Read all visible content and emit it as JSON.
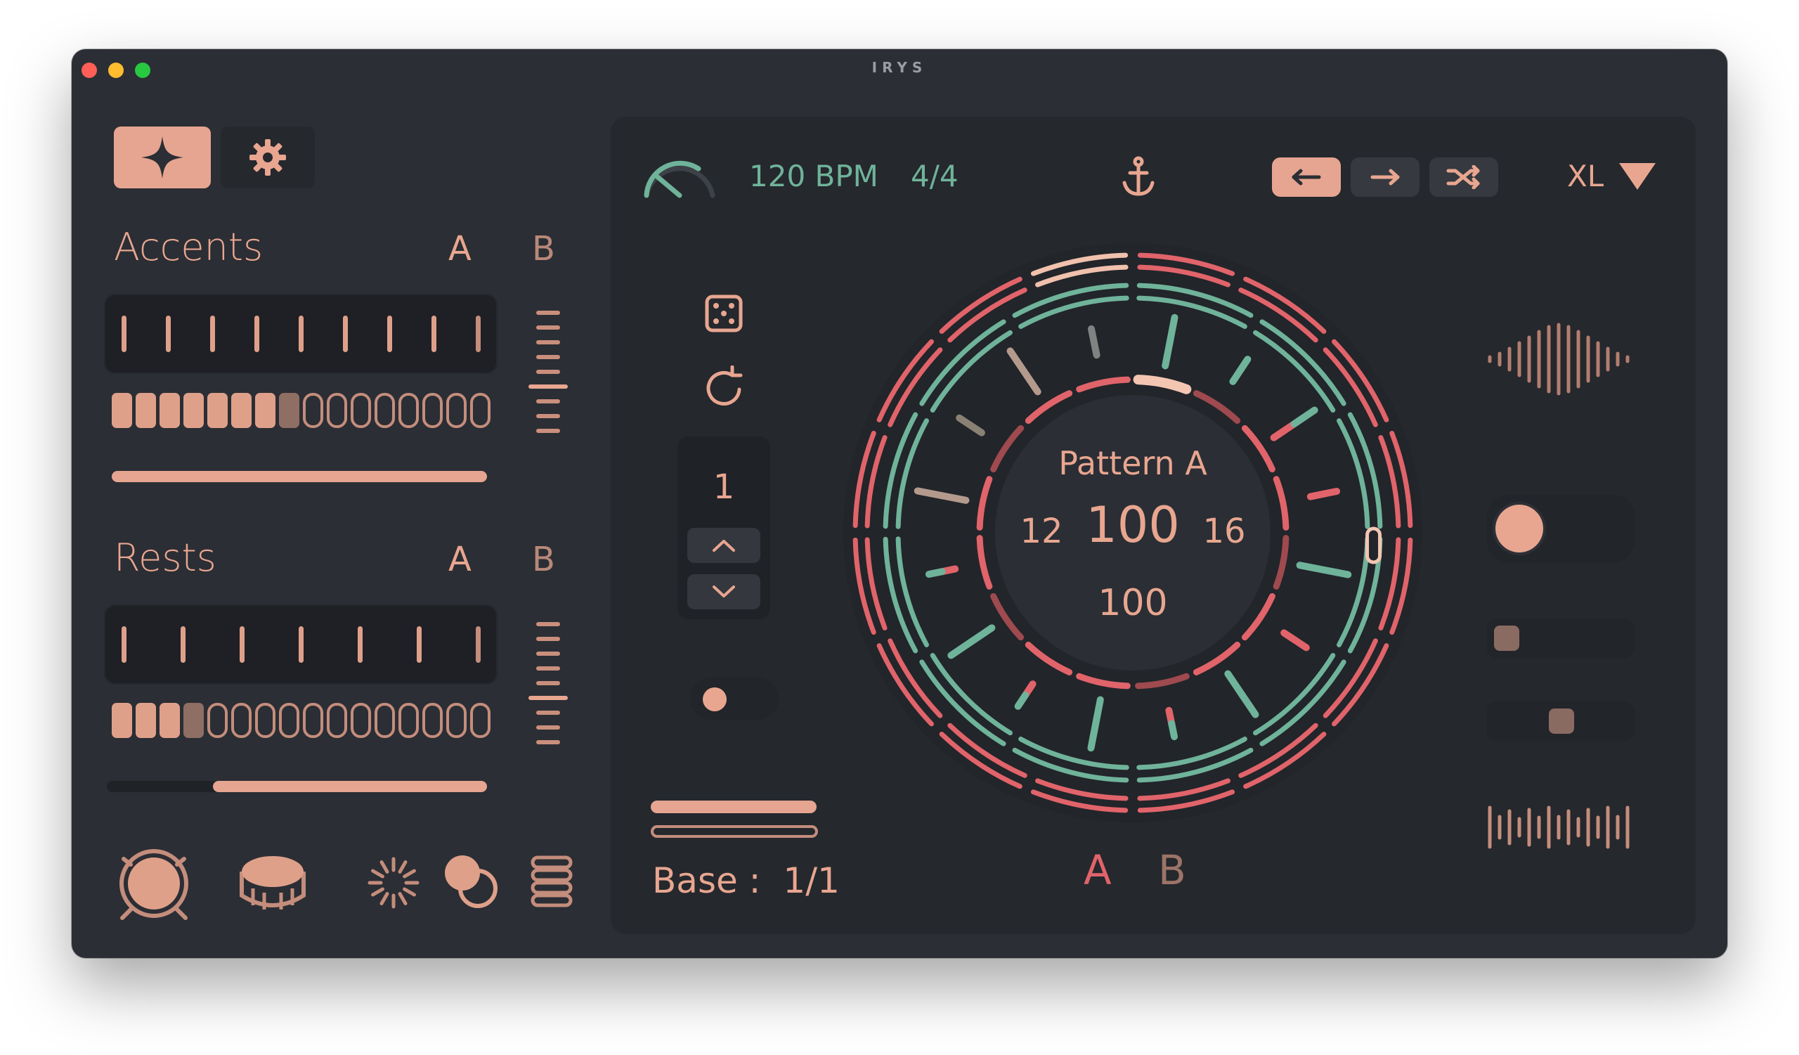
{
  "window": {
    "title": "IRYS",
    "traffic_lights": {
      "close": "#ff5f57",
      "minimize": "#febc2e",
      "zoom": "#28c840"
    }
  },
  "colors": {
    "accent": "#e8a690",
    "teal": "#6fb39a",
    "red": "#e0646a",
    "panel": "#25282d",
    "window": "#2b2e34"
  },
  "sidebar": {
    "tabs": [
      {
        "icon": "sparkle-icon",
        "active": true
      },
      {
        "icon": "gear-icon",
        "active": false
      }
    ],
    "accents": {
      "title": "Accents",
      "a_label": "A",
      "b_label": "B",
      "tick_count": 9,
      "cells_on": 7,
      "cells_mid": 1,
      "cells_total": 16,
      "slider_value": 1.0
    },
    "rests": {
      "title": "Rests",
      "a_label": "A",
      "b_label": "B",
      "tick_count": 7,
      "cells_on": 3,
      "cells_mid": 1,
      "cells_total": 16,
      "slider_value": 0.72
    },
    "instruments": [
      "kick-drum-icon",
      "snare-drum-icon",
      "sparkle-burst-icon",
      "overlap-circles-icon",
      "stack-icon"
    ]
  },
  "transport": {
    "bpm": "120 BPM",
    "time_signature": "4/4",
    "anchor_icon": "anchor-icon",
    "directions": [
      {
        "icon": "arrow-left-icon",
        "active": true
      },
      {
        "icon": "arrow-right-icon",
        "active": false
      },
      {
        "icon": "shuffle-icon",
        "active": false
      }
    ],
    "size_label": "XL"
  },
  "tools": {
    "dice_icon": "dice-icon",
    "reload_icon": "reload-icon",
    "stepper_value": "1",
    "base_label": "Base :",
    "base_value": "1/1"
  },
  "wheel": {
    "pattern_label": "Pattern A",
    "left_value": "12",
    "center_value": "100",
    "right_value": "16",
    "bottom_value": "100",
    "a_label": "A",
    "b_label": "B"
  }
}
